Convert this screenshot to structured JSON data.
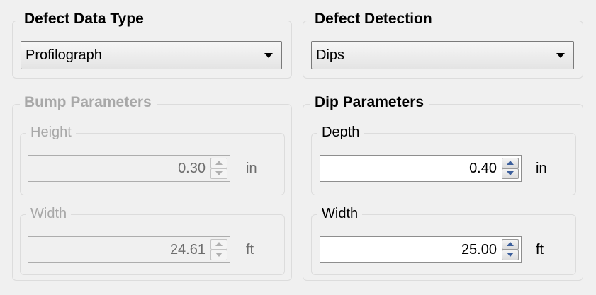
{
  "defect_data_type": {
    "title": "Defect Data Type",
    "selected": "Profilograph"
  },
  "defect_detection": {
    "title": "Defect Detection",
    "selected": "Dips"
  },
  "bump_parameters": {
    "title": "Bump Parameters",
    "enabled": false,
    "height": {
      "label": "Height",
      "value": "0.30",
      "unit": "in"
    },
    "width": {
      "label": "Width",
      "value": "24.61",
      "unit": "ft"
    }
  },
  "dip_parameters": {
    "title": "Dip Parameters",
    "enabled": true,
    "depth": {
      "label": "Depth",
      "value": "0.40",
      "unit": "in"
    },
    "width": {
      "label": "Width",
      "value": "25.00",
      "unit": "ft"
    }
  },
  "icons": {
    "dropdown": "chevron-down-icon",
    "spin_up": "spin-up-icon",
    "spin_down": "spin-down-icon"
  }
}
